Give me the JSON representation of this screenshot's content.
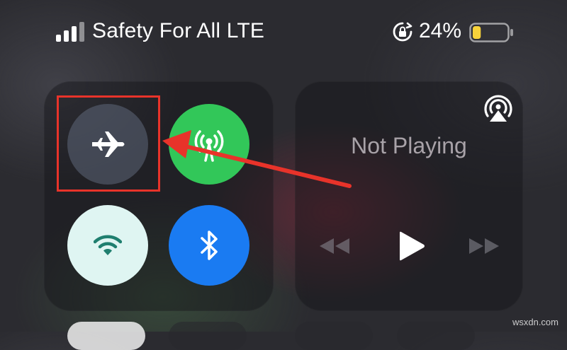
{
  "status_bar": {
    "carrier": "Safety For All LTE",
    "battery_percent": "24%",
    "battery_level": 0.24,
    "battery_color": "#f7d23a",
    "signal_icon": "cellular-signal-icon",
    "rotation_lock_icon": "rotation-lock-icon"
  },
  "connectivity": {
    "buttons": [
      {
        "name": "airplane-mode",
        "icon": "airplane-icon",
        "state": "off",
        "color": "#6e7890"
      },
      {
        "name": "cellular-data",
        "icon": "antenna-icon",
        "state": "on",
        "color": "#32c759"
      },
      {
        "name": "wifi",
        "icon": "wifi-icon",
        "state": "off",
        "color": "#dff5f2"
      },
      {
        "name": "bluetooth",
        "icon": "bluetooth-icon",
        "state": "on",
        "color": "#1a7bf2"
      }
    ]
  },
  "media": {
    "status": "Not Playing",
    "airplay_icon": "airplay-icon",
    "controls": [
      "rewind-icon",
      "play-icon",
      "fast-forward-icon"
    ]
  },
  "annotation": {
    "highlight_color": "#e8332a"
  },
  "watermark": "wsxdn.com"
}
